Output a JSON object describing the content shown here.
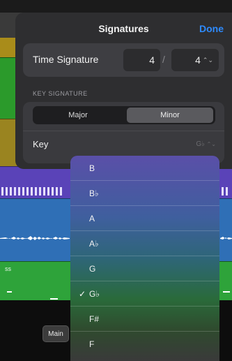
{
  "panel": {
    "title": "Signatures",
    "done_label": "Done"
  },
  "time_signature": {
    "label": "Time Signature",
    "numerator": "4",
    "separator": "/",
    "denominator": "4"
  },
  "key_signature": {
    "header": "KEY SIGNATURE",
    "modes": [
      "Major",
      "Minor"
    ],
    "selected_mode": "Minor",
    "key_label": "Key",
    "key_value": "G♭"
  },
  "dropdown": {
    "items": [
      "B",
      "B♭",
      "A",
      "A♭",
      "G",
      "G♭",
      "F#",
      "F"
    ],
    "selected": "G♭",
    "check_glyph": "✓"
  },
  "tracks": {
    "track_label": "ss",
    "main_button": "Main"
  },
  "colors": {
    "accent": "#2e8bff",
    "panel": "#2e2e30"
  }
}
